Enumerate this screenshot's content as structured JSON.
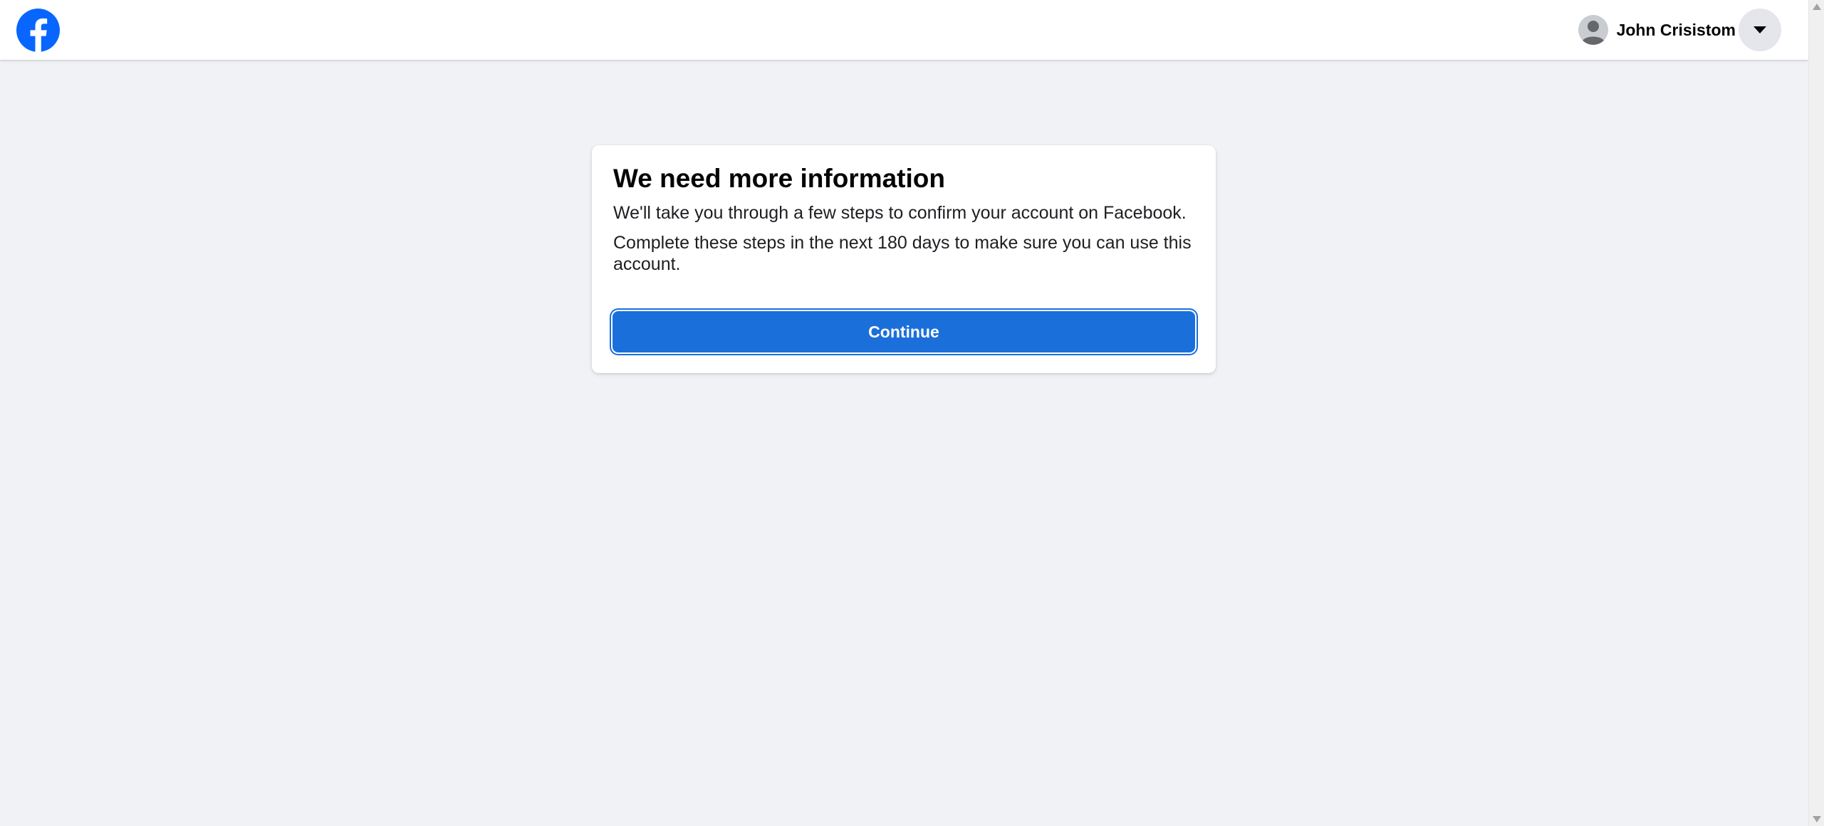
{
  "header": {
    "logo_icon": "facebook-logo-icon",
    "user_name": "John Crisistom",
    "avatar_icon": "default-avatar-icon",
    "menu_icon": "caret-down-icon"
  },
  "card": {
    "title": "We need more information",
    "paragraph_1": "We'll take you through a few steps to confirm your account on Facebook.",
    "paragraph_2": "Complete these steps in the next 180 days to make sure you can use this account.",
    "continue_label": "Continue"
  },
  "colors": {
    "brand_blue": "#0866ff",
    "button_blue": "#1b6fdb",
    "page_background": "#f0f2f5"
  }
}
